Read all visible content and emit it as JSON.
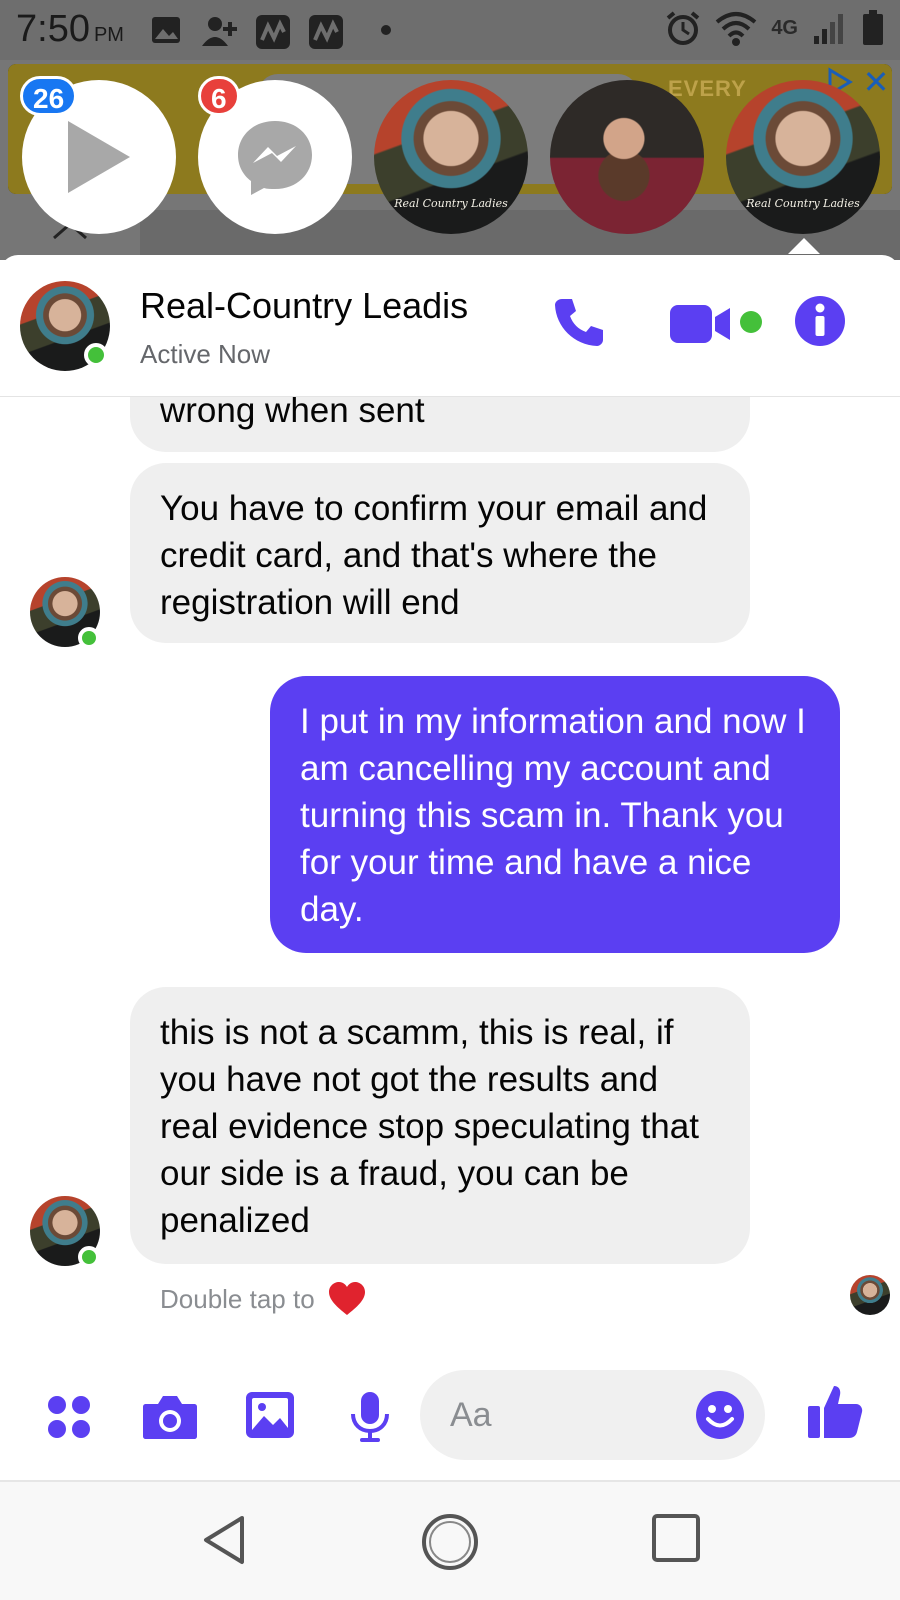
{
  "status_bar": {
    "time": "7:50",
    "ampm": "PM",
    "network": "4G",
    "icons": [
      "image-icon",
      "add-person-icon",
      "app-icon",
      "app-icon",
      "dot-icon",
      "alarm-icon",
      "wifi-icon",
      "signal-icon",
      "battery-icon"
    ]
  },
  "ad": {
    "text": "EVERY"
  },
  "chat_heads": [
    {
      "kind": "video",
      "badge": "26",
      "badge_color": "#1877f2"
    },
    {
      "kind": "messenger",
      "badge": "6",
      "badge_color": "#e8403b"
    },
    {
      "kind": "contact",
      "caption": "Real Country Ladies"
    },
    {
      "kind": "contact"
    },
    {
      "kind": "contact",
      "caption": "Real Country Ladies"
    }
  ],
  "header": {
    "name": "Real-Country Leadis",
    "status": "Active Now",
    "accent": "#5b3ff2",
    "online_color": "#44c03a"
  },
  "messages": [
    {
      "side": "in",
      "text": "wrong when sent"
    },
    {
      "side": "in",
      "text": "You have to confirm your email and credit card, and that's where the registration will end"
    },
    {
      "side": "out",
      "text": "I put in my information and now I am cancelling my account and turning this scam in. Thank you for your time and have a nice day."
    },
    {
      "side": "in",
      "text": "this is not a scamm, this is real, if you have not got the results and real evidence stop speculating that our side is a fraud, you can be penalized"
    }
  ],
  "reaction_hint": "Double tap to",
  "composer": {
    "placeholder": "Aa",
    "icons": [
      "apps-icon",
      "camera-icon",
      "gallery-icon",
      "microphone-icon",
      "emoji-icon",
      "thumbs-up-icon"
    ]
  },
  "nav": [
    "back-icon",
    "home-icon",
    "recents-icon"
  ]
}
